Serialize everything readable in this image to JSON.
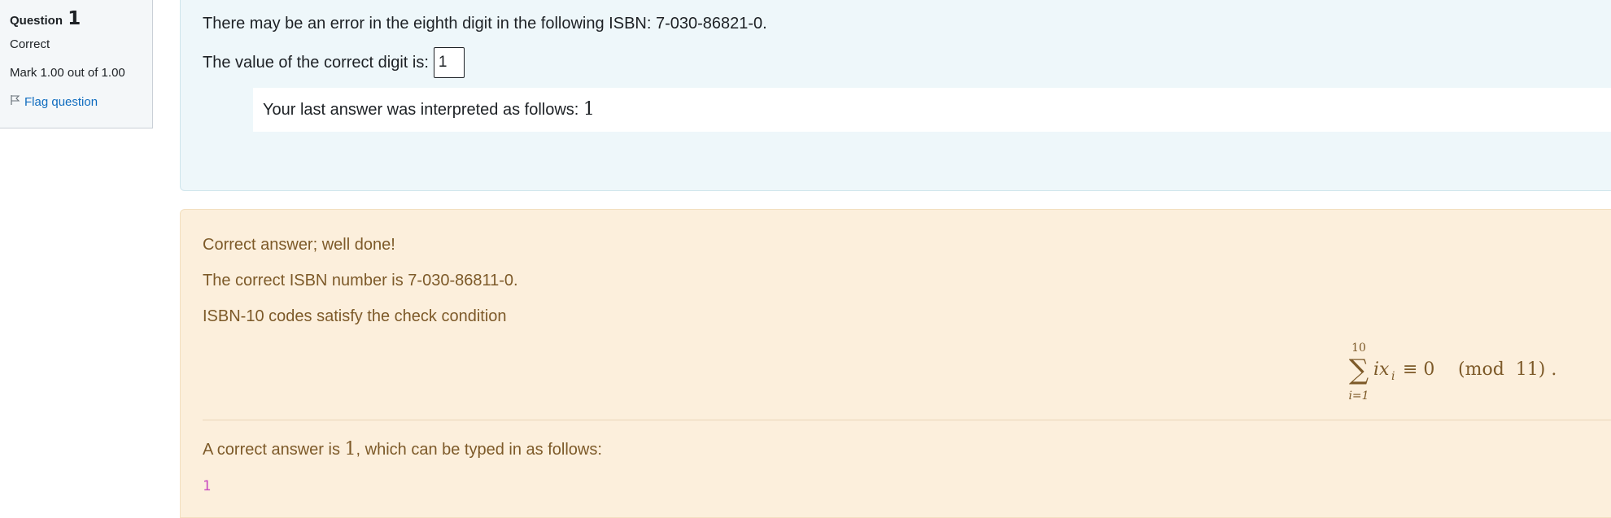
{
  "info": {
    "question_label": "Question",
    "question_number": "1",
    "state": "Correct",
    "grade": "Mark 1.00 out of 1.00",
    "flag_label": "Flag question"
  },
  "formulation": {
    "question_text": "There may be an error in the eighth digit in the following ISBN: 7-030-86821-0.",
    "prompt": "The value of the correct digit is:",
    "answer_value": "1",
    "interpreted_prefix": "Your last answer was interpreted as follows:",
    "interpreted_value": "1"
  },
  "outcome": {
    "feedback_1": "Correct answer; well done!",
    "feedback_2": "The correct ISBN number is 7-030-86811-0.",
    "feedback_3": "ISBN-10 codes satisfy the check condition",
    "formula": {
      "upper": "10",
      "lower": "i=1",
      "body": "ix",
      "sub": "i",
      "equiv": "≡ 0",
      "mod": "(mod  11) ."
    },
    "right_answer_prefix": "A correct answer is",
    "right_answer_value": "1",
    "right_answer_suffix": ", which can be typed in as follows:",
    "typed_answer": "1"
  },
  "colors": {
    "formulation_bg": "#eef7fa",
    "outcome_bg": "#fcefdc",
    "outcome_text": "#7d5a29",
    "link": "#0f6cbf",
    "code": "#c84ac0"
  }
}
